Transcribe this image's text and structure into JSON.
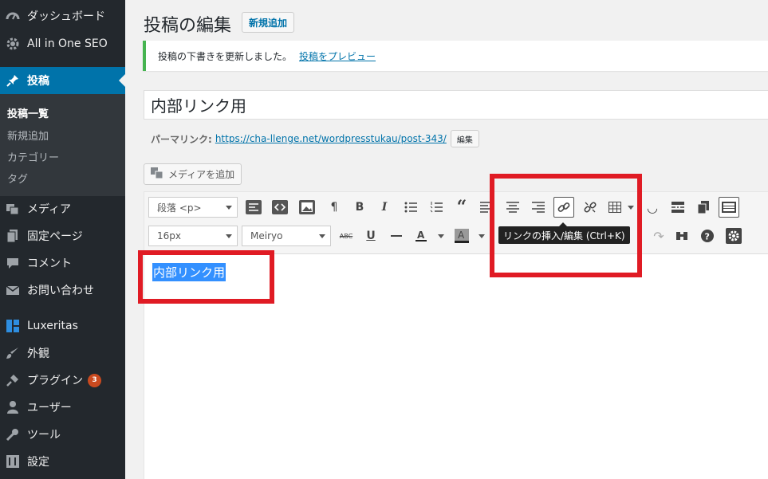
{
  "sidebar": {
    "items": [
      {
        "label": "ダッシュボード",
        "icon": "dashboard-icon"
      },
      {
        "label": "All in One SEO",
        "icon": "gear-icon"
      },
      {
        "label": "投稿",
        "icon": "pin-icon"
      },
      {
        "label": "メディア",
        "icon": "media-icon"
      },
      {
        "label": "固定ページ",
        "icon": "page-icon"
      },
      {
        "label": "コメント",
        "icon": "comment-icon"
      },
      {
        "label": "お問い合わせ",
        "icon": "mail-icon"
      },
      {
        "label": "Luxeritas",
        "icon": "grid-icon"
      },
      {
        "label": "外観",
        "icon": "brush-icon"
      },
      {
        "label": "プラグイン",
        "icon": "plugin-icon",
        "badge": "3"
      },
      {
        "label": "ユーザー",
        "icon": "user-icon"
      },
      {
        "label": "ツール",
        "icon": "wrench-icon"
      },
      {
        "label": "設定",
        "icon": "settings-icon"
      }
    ],
    "submenu": [
      "投稿一覧",
      "新規追加",
      "カテゴリー",
      "タグ"
    ]
  },
  "header": {
    "title": "投稿の編集",
    "add_new": "新規追加"
  },
  "notice": {
    "text": "投稿の下書きを更新しました。",
    "link": "投稿をプレビュー"
  },
  "post": {
    "title": "内部リンク用",
    "permalink_label": "パーマリンク:",
    "permalink_url": "https://cha-llenge.net/wordpresstukau/post-343/",
    "permalink_edit": "編集",
    "add_media": "メディアを追加",
    "content": "内部リンク用"
  },
  "toolbar": {
    "format": "段落 <p>",
    "font_size": "16px",
    "font_family": "Meiryo",
    "tooltip": "リンクの挿入/編集 (Ctrl+K)"
  },
  "colors": {
    "sidebar_bg": "#23282d",
    "active_blue": "#0073aa",
    "annotation_red": "#e01b24",
    "selection_blue": "#3390ff"
  }
}
